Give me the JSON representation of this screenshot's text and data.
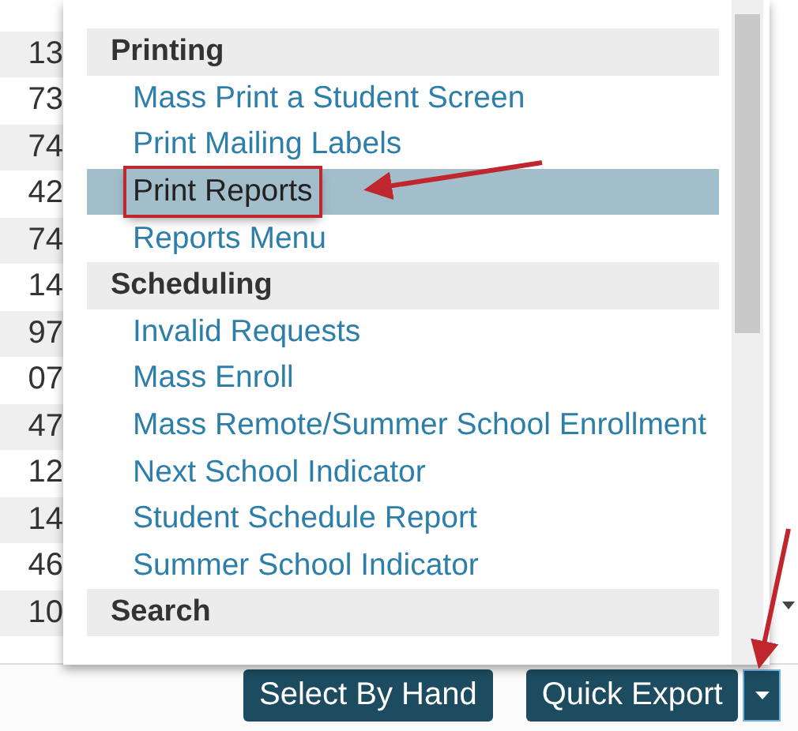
{
  "background_rows": [
    "13",
    "73",
    "74",
    "42",
    "74",
    "14",
    "97",
    "07",
    "47",
    "12",
    "14",
    "46",
    "10"
  ],
  "menu": {
    "groups": [
      {
        "heading": "Printing",
        "items": [
          {
            "label": "Mass Print a Student Screen",
            "selected": false,
            "annotated": false
          },
          {
            "label": "Print Mailing Labels",
            "selected": false,
            "annotated": false
          },
          {
            "label": "Print Reports",
            "selected": true,
            "annotated": true
          },
          {
            "label": "Reports Menu",
            "selected": false,
            "annotated": false
          }
        ]
      },
      {
        "heading": "Scheduling",
        "items": [
          {
            "label": "Invalid Requests",
            "selected": false,
            "annotated": false
          },
          {
            "label": "Mass Enroll",
            "selected": false,
            "annotated": false
          },
          {
            "label": "Mass Remote/Summer School Enrollment",
            "selected": false,
            "annotated": false
          },
          {
            "label": "Next School Indicator",
            "selected": false,
            "annotated": false
          },
          {
            "label": "Student Schedule Report",
            "selected": false,
            "annotated": false
          },
          {
            "label": "Summer School Indicator",
            "selected": false,
            "annotated": false
          }
        ]
      },
      {
        "heading": "Search"
      }
    ]
  },
  "buttons": [
    {
      "label": "Select By Hand",
      "kind": "button",
      "focused": false
    },
    {
      "label": "Quick Export",
      "kind": "split",
      "focused": true
    }
  ]
}
